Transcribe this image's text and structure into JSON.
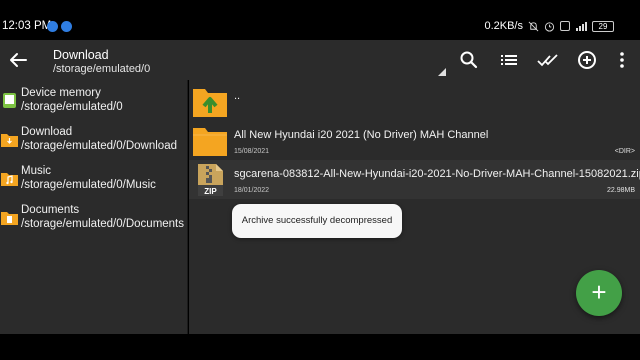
{
  "status_bar": {
    "time": "12:03 PM",
    "speed": "0.2KB/s",
    "battery": "29",
    "icons": [
      "message-icon",
      "message-icon",
      "mute-icon",
      "alarm-icon",
      "vowifi-icon",
      "4g-signal-icon",
      "battery-icon"
    ]
  },
  "appbar": {
    "title": "Download",
    "subtitle": "/storage/emulated/0",
    "icons": [
      "back-arrow-icon",
      "search-icon",
      "list-view-icon",
      "select-all-icon",
      "add-circle-icon",
      "more-vert-icon"
    ]
  },
  "sidebar": {
    "items": [
      {
        "label": "Device memory",
        "path": "/storage/emulated/0",
        "icon": "device-storage-icon",
        "color": "#7cc242"
      },
      {
        "label": "Download",
        "path": "/storage/emulated/0/Download",
        "icon": "download-folder-icon",
        "color": "#f4a521"
      },
      {
        "label": "Music",
        "path": "/storage/emulated/0/Music",
        "icon": "music-folder-icon",
        "color": "#f4a521"
      },
      {
        "label": "Documents",
        "path": "/storage/emulated/0/Documents",
        "icon": "documents-folder-icon",
        "color": "#f4a521"
      }
    ]
  },
  "files": [
    {
      "name": "..",
      "date": "",
      "meta": "",
      "icon": "parent-folder-up-icon"
    },
    {
      "name": "All New Hyundai i20 2021 (No Driver) MAH Channel",
      "date": "15/08/2021",
      "meta": "<DIR>",
      "icon": "folder-icon"
    },
    {
      "name": "sgcarena-083812-All-New-Hyundai-i20-2021-No-Driver-MAH-Channel-15082021.zip",
      "date": "18/01/2022",
      "meta": "22.98MB",
      "icon": "zip-file-icon"
    }
  ],
  "toast": {
    "message": "Archive successfully decompressed"
  },
  "fab": {
    "label": "+"
  },
  "colors": {
    "accent": "#43a047",
    "folder": "#f4a521",
    "background": "#2b2b2b"
  }
}
